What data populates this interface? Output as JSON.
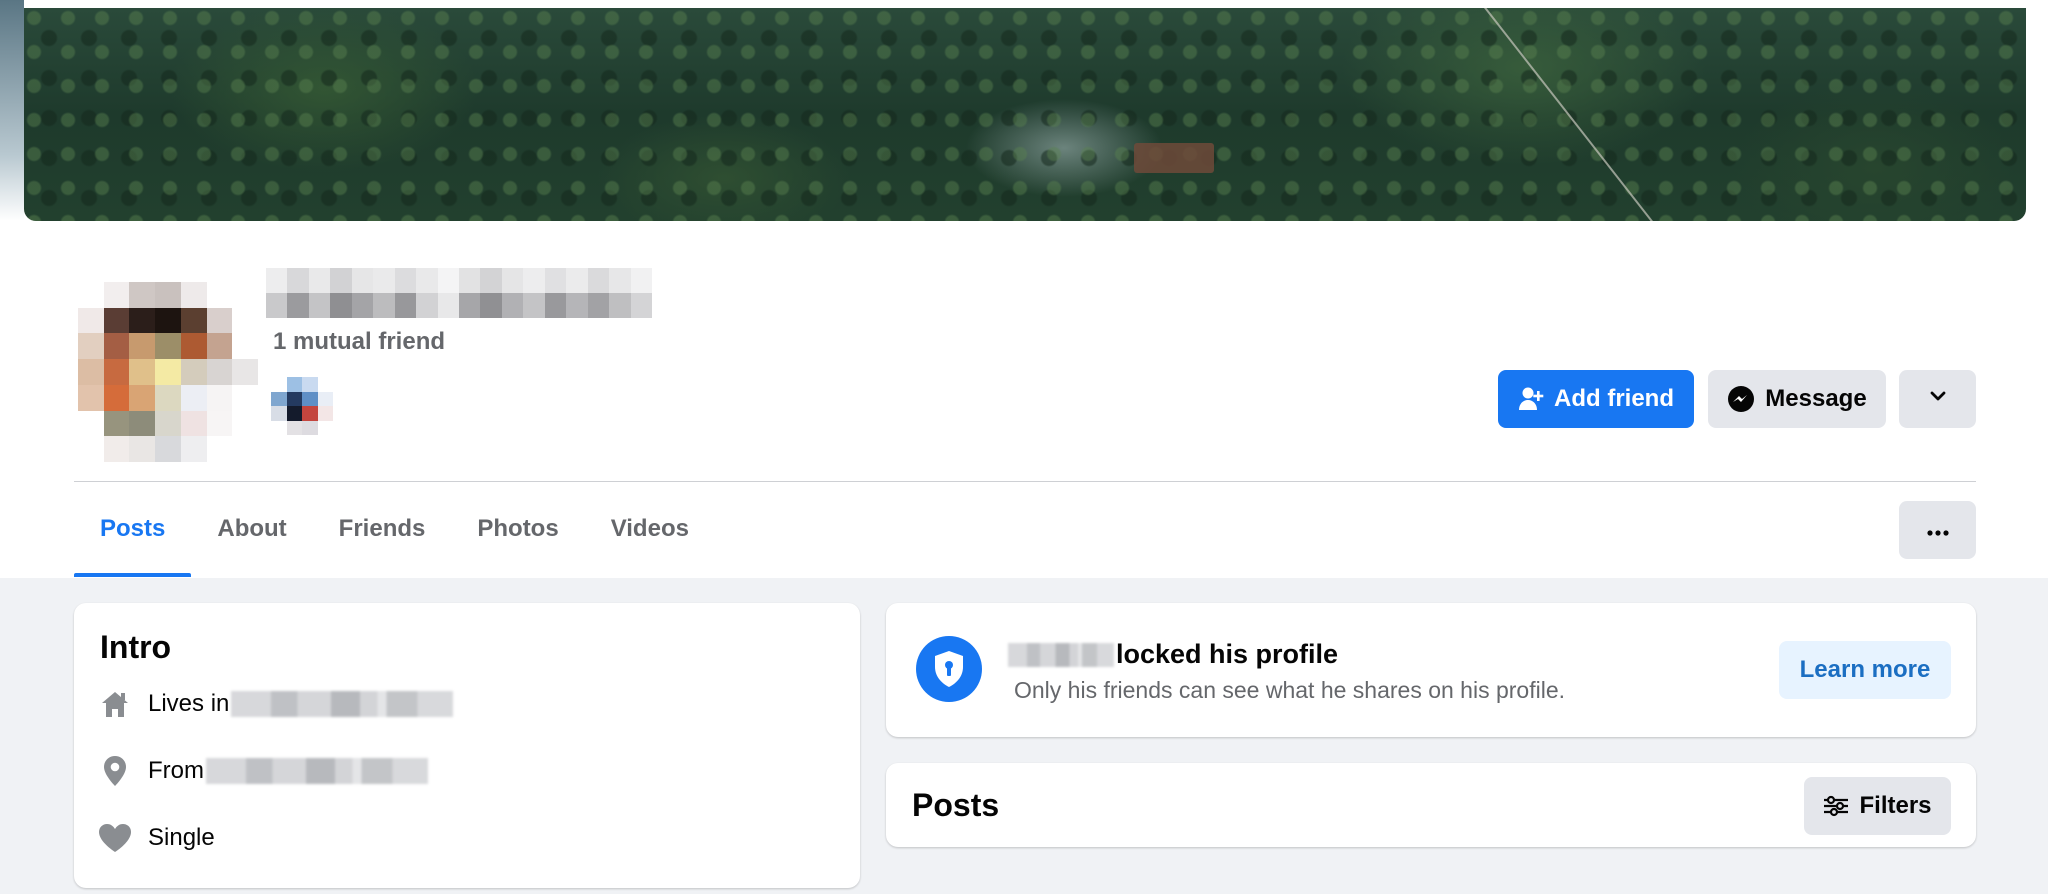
{
  "profile": {
    "mutual_friends": "1 mutual friend"
  },
  "actions": {
    "add_friend": "Add friend",
    "message": "Message"
  },
  "tabs": [
    {
      "label": "Posts",
      "active": true
    },
    {
      "label": "About",
      "active": false
    },
    {
      "label": "Friends",
      "active": false
    },
    {
      "label": "Photos",
      "active": false
    },
    {
      "label": "Videos",
      "active": false
    }
  ],
  "intro": {
    "title": "Intro",
    "lives_in_label": "Lives in",
    "from_label": "From",
    "relationship": "Single"
  },
  "locked": {
    "title_suffix": "locked his profile",
    "subtitle": "Only his friends can see what he shares on his profile.",
    "learn_more": "Learn more"
  },
  "posts_section": {
    "title": "Posts",
    "filters": "Filters"
  },
  "colors": {
    "accent": "#1877f2",
    "background": "#f0f2f5",
    "secondary_button": "#e4e6eb",
    "muted_text": "#65676b"
  },
  "icons": [
    "add-person-icon",
    "messenger-icon",
    "chevron-down-icon",
    "more-dots-icon",
    "home-icon",
    "location-pin-icon",
    "heart-icon",
    "shield-lock-icon",
    "filters-icon"
  ]
}
